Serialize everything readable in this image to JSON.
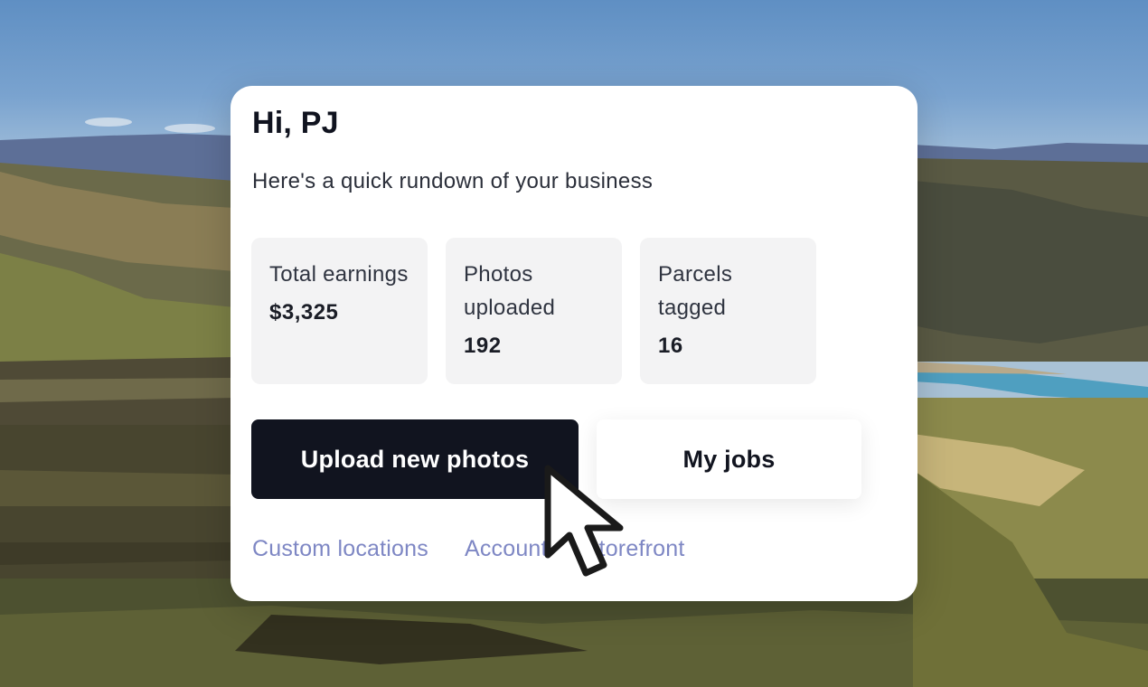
{
  "greeting": "Hi, PJ",
  "subtitle": "Here's a quick rundown of your business",
  "stats": [
    {
      "label": "Total earnings",
      "value": "$3,325"
    },
    {
      "label": "Photos uploaded",
      "value": "192"
    },
    {
      "label": "Parcels tagged",
      "value": "16"
    }
  ],
  "actions": {
    "primary_label": "Upload new photos",
    "secondary_label": "My jobs"
  },
  "links": [
    "Custom locations",
    "Account",
    "Storefront"
  ],
  "colors": {
    "primary_button": "#11141f",
    "link": "#7e87c4",
    "card": "#ffffff",
    "stat_tile": "#f3f3f4"
  },
  "icons": {
    "cursor": "arrow-cursor-icon"
  }
}
